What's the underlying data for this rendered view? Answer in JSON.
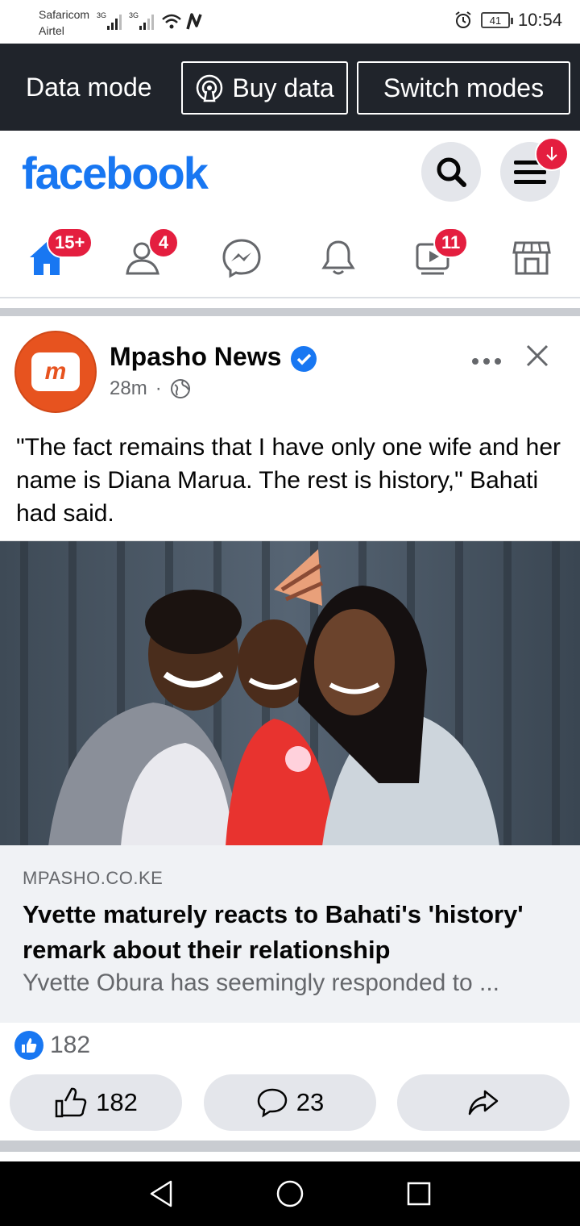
{
  "status_bar": {
    "carrier1": "Safaricom",
    "carrier2": "Airtel",
    "net1": "3G",
    "net2": "3G",
    "battery": "41",
    "time": "10:54"
  },
  "data_mode_bar": {
    "label": "Data mode",
    "buy_data": "Buy data",
    "switch_modes": "Switch modes"
  },
  "header": {
    "logo": "facebook",
    "brand_color": "#1877f2",
    "menu_badge_icon": "download-arrow-icon"
  },
  "nav": {
    "home_badge": "15+",
    "friends_badge": "4",
    "video_badge": "11",
    "icons": [
      "home-icon",
      "friends-icon",
      "messenger-icon",
      "notifications-icon",
      "watch-icon",
      "marketplace-icon"
    ]
  },
  "post": {
    "page_name": "Mpasho News",
    "time": "28m",
    "dot": "·",
    "avatar_text": "m",
    "text": "\"The fact remains that I have only one wife and her name is Diana Marua. The rest is history,\" Bahati had said.",
    "link": {
      "domain": "MPASHO.CO.KE",
      "title": "Yvette maturely reacts to Bahati's 'history' remark about their relationship",
      "description": "Yvette Obura has seemingly responded to ..."
    },
    "reactions_count": "182",
    "like_count": "182",
    "comment_count": "23"
  }
}
